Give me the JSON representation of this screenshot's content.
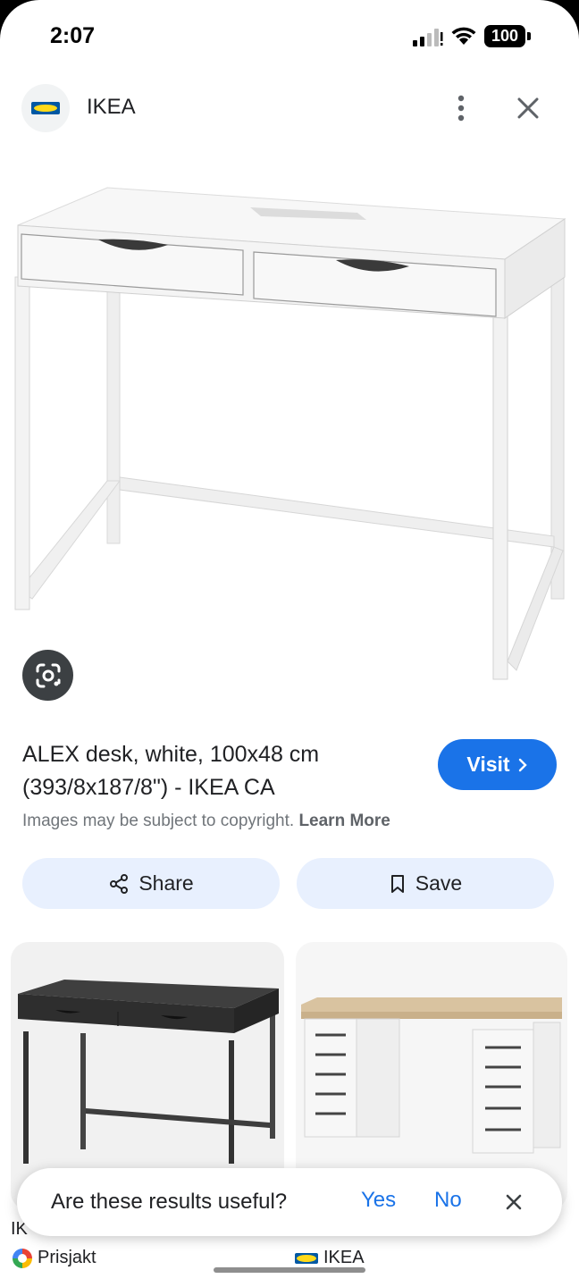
{
  "status_bar": {
    "time": "2:07",
    "battery": "100"
  },
  "header": {
    "site_name": "IKEA"
  },
  "result": {
    "title": "ALEX desk, white, 100x48 cm (393/8x187/8\") - IKEA CA",
    "visit_label": "Visit",
    "copyright_text": "Images may be subject to copyright.",
    "learn_more": "Learn More"
  },
  "actions": {
    "share_label": "Share",
    "save_label": "Save"
  },
  "related": [
    {
      "caption": "IK",
      "source": "Prisjakt"
    },
    {
      "caption": "",
      "source": "IKEA"
    }
  ],
  "feedback": {
    "question": "Are these results useful?",
    "yes": "Yes",
    "no": "No"
  },
  "colors": {
    "accent": "#1a73e8",
    "chip_bg": "#e8f0fe",
    "ikea_blue": "#0058a3",
    "ikea_yellow": "#ffda1a"
  }
}
